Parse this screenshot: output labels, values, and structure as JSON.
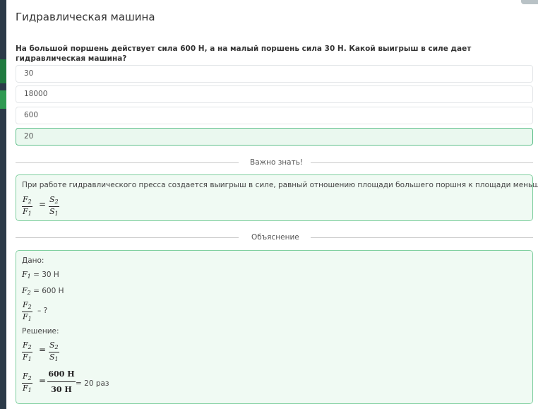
{
  "title": "Гидравлическая машина",
  "question": "На большой поршень действует сила 600 Н, а на малый поршень сила 30 Н. Какой выигрыш в силе дает гидравлическая машина?",
  "options": [
    {
      "label": "30",
      "correct": false
    },
    {
      "label": "18000",
      "correct": false
    },
    {
      "label": "600",
      "correct": false
    },
    {
      "label": "20",
      "correct": true
    }
  ],
  "important": {
    "heading": "Важно знать!",
    "text": "При работе гидравлического пресса создается выигрыш в силе, равный отношению площади большего поршня к площади меньшего.",
    "formula": {
      "lhs_num": "F",
      "lhs_num_sub": "2",
      "lhs_den": "F",
      "lhs_den_sub": "1",
      "eq": "=",
      "rhs_num": "S",
      "rhs_num_sub": "2",
      "rhs_den": "S",
      "rhs_den_sub": "1"
    }
  },
  "explanation": {
    "heading": "Объяснение",
    "given_label": "Дано:",
    "f1_var": "F",
    "f1_sub": "1",
    "f1_value": " = 30 Н",
    "f2_var": "F",
    "f2_sub": "2",
    "f2_value": " = 600 Н",
    "ratio_unknown": " – ?",
    "solution_label": "Решение:",
    "calc_num": "600 Н",
    "calc_den": "30 Н",
    "result": " = 20 раз"
  },
  "colors": {
    "correct_bg": "#eaf8ef",
    "correct_border": "#5fc08b",
    "box_bg": "#f0faf3",
    "sidebar": "#2b3a48",
    "sidebar_accent": "#1f7a3f"
  }
}
